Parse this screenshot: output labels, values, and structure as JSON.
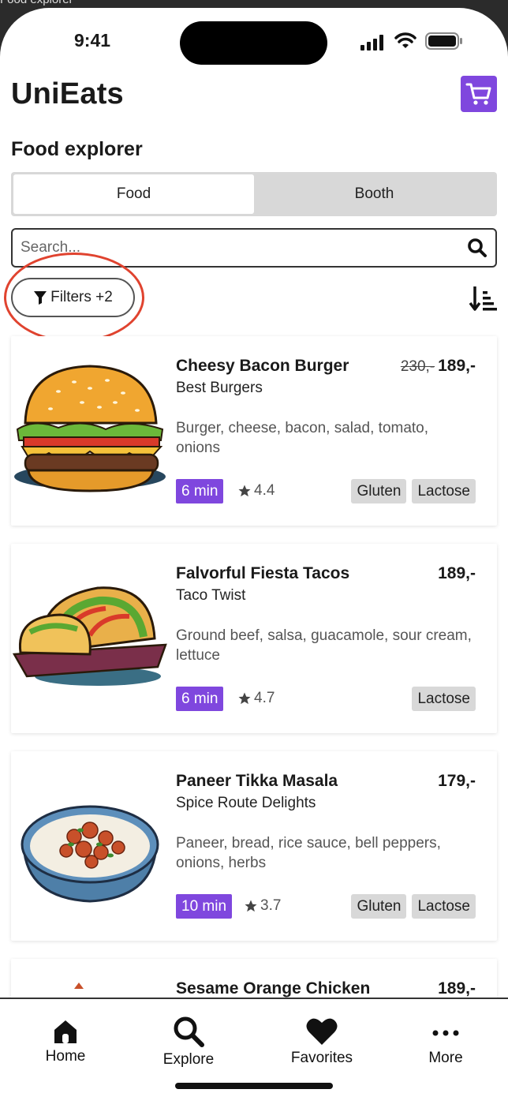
{
  "window_title": "Food explorer",
  "status_bar": {
    "time": "9:41"
  },
  "header": {
    "app_title": "UniEats"
  },
  "section_title": "Food explorer",
  "segments": {
    "food": "Food",
    "booth": "Booth",
    "active": "Food"
  },
  "search": {
    "placeholder": "Search...",
    "value": ""
  },
  "filters": {
    "label": "Filters +2"
  },
  "colors": {
    "accent": "#7f47de",
    "annotation": "#e0432f",
    "tag_bg": "#d8d8d8"
  },
  "items": [
    {
      "name": "Cheesy Bacon Burger",
      "booth": "Best Burgers",
      "old_price": "230,-",
      "price": "189,-",
      "description": "Burger, cheese, bacon, salad, tomato, onions",
      "time": "6 min",
      "rating": "4.4",
      "tags": [
        "Gluten",
        "Lactose"
      ],
      "image": "burger-image"
    },
    {
      "name": "Falvorful Fiesta Tacos",
      "booth": "Taco Twist",
      "price": "189,-",
      "description": "Ground beef, salsa, guacamole, sour cream, lettuce",
      "time": "6 min",
      "rating": "4.7",
      "tags": [
        "Lactose"
      ],
      "image": "tacos-image"
    },
    {
      "name": "Paneer Tikka Masala",
      "booth": "Spice Route Delights",
      "price": "179,-",
      "description": "Paneer, bread, rice sauce, bell peppers, onions, herbs",
      "time": "10 min",
      "rating": "3.7",
      "tags": [
        "Gluten",
        "Lactose"
      ],
      "image": "curry-bowl-image"
    },
    {
      "name": "Sesame Orange Chicken",
      "price": "189,-"
    }
  ],
  "tab_bar": {
    "home": "Home",
    "explore": "Explore",
    "favorites": "Favorites",
    "more": "More"
  }
}
